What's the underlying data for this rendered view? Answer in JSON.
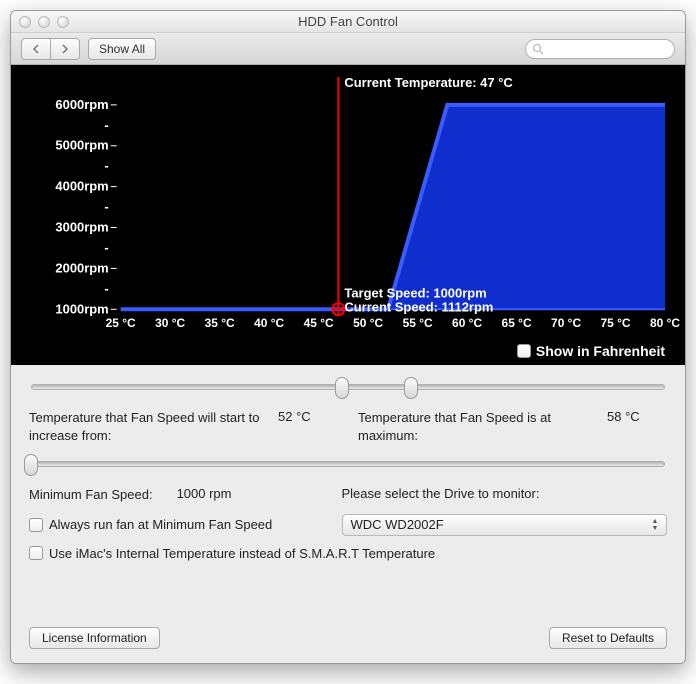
{
  "window": {
    "title": "HDD Fan Control"
  },
  "toolbar": {
    "back_aria": "Back",
    "forward_aria": "Forward",
    "show_all": "Show All",
    "search_placeholder": ""
  },
  "chart_data": {
    "type": "area",
    "xlabel": "",
    "ylabel": "",
    "x_unit": "°C",
    "y_unit": "rpm",
    "x_ticks": [
      25,
      30,
      35,
      40,
      45,
      50,
      55,
      60,
      65,
      70,
      75,
      80
    ],
    "y_ticks": [
      1000,
      2000,
      3000,
      4000,
      5000,
      6000
    ],
    "curve": [
      {
        "x": 25,
        "y": 1000
      },
      {
        "x": 52,
        "y": 1000
      },
      {
        "x": 58,
        "y": 6000
      },
      {
        "x": 80,
        "y": 6000
      }
    ],
    "current_temp_c": 47,
    "target_speed_rpm": 1000,
    "current_speed_rpm": 1112,
    "current_temp_label": "Current Temperature: 47 °C",
    "target_speed_label": "Target Speed: 1000rpm",
    "current_speed_label": "Current Speed: 1112rpm",
    "x_tick_labels": [
      "25 °C",
      "30 °C",
      "35 °C",
      "40 °C",
      "45 °C",
      "50 °C",
      "55 °C",
      "60 °C",
      "65 °C",
      "70 °C",
      "75 °C",
      "80 °C"
    ],
    "y_tick_labels": [
      "1000rpm",
      "2000rpm",
      "3000rpm",
      "4000rpm",
      "5000rpm",
      "6000rpm"
    ]
  },
  "fahrenheit": {
    "label": "Show in Fahrenheit",
    "checked": false
  },
  "ramp": {
    "start_label": "Temperature that Fan Speed will start to increase from:",
    "start_value": "52 °C",
    "start_pos": 0.49,
    "max_label": "Temperature that Fan Speed is at maximum:",
    "max_value": "58 °C",
    "max_pos": 0.6
  },
  "min_speed": {
    "label": "Minimum Fan Speed:",
    "value": "1000  rpm",
    "pos": 0.0
  },
  "drive": {
    "label": "Please select the Drive to monitor:",
    "selected": "WDC WD2002F"
  },
  "always_min": {
    "label": "Always run fan at Minimum Fan Speed",
    "checked": false
  },
  "use_internal": {
    "label": "Use iMac's Internal Temperature instead of S.M.A.R.T Temperature",
    "checked": false
  },
  "buttons": {
    "license": "License Information",
    "reset": "Reset to Defaults"
  },
  "colors": {
    "curve": "#1030d8",
    "fill": "#1030d8",
    "marker": "#ff0000"
  }
}
